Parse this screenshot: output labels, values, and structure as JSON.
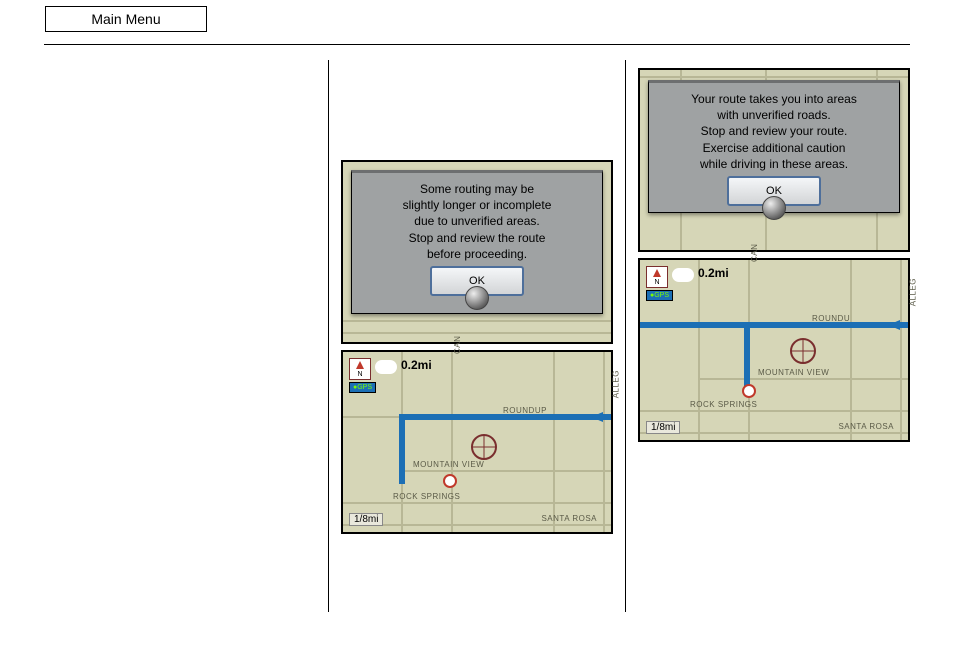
{
  "header": {
    "main_menu": "Main Menu"
  },
  "col2": {
    "dialog": {
      "line1": "Some routing may be",
      "line2": "slightly longer or incomplete",
      "line3": "due to unverified areas.",
      "line4": "Stop and review the route",
      "line5": "before proceeding.",
      "ok": "OK"
    },
    "map": {
      "compass_letter": "N",
      "gps": "●GPS",
      "distance": "0.2mi",
      "scale": "1/8mi",
      "labels": {
        "roundup": "ROUNDUP",
        "mountain_view": "MOUNTAIN VIEW",
        "rock_springs": "ROCK SPRINGS",
        "santa_rosa": "SANTA ROSA",
        "alleg": "ALLEG",
        "can": "CAN"
      }
    }
  },
  "col3": {
    "dialog": {
      "line1": "Your route takes you into areas",
      "line2": "with unverified roads.",
      "line3": "Stop and review your route.",
      "line4": "Exercise additional caution",
      "line5": "while driving in these areas.",
      "ok": "OK"
    },
    "map": {
      "compass_letter": "N",
      "gps": "●GPS",
      "distance": "0.2mi",
      "scale": "1/8mi",
      "labels": {
        "roundup": "ROUNDU",
        "mountain_view": "MOUNTAIN VIEW",
        "rock_springs": "ROCK SPRINGS",
        "santa_rosa": "SANTA ROSA",
        "alleg": "ALLEG",
        "can": "CAN"
      }
    }
  }
}
